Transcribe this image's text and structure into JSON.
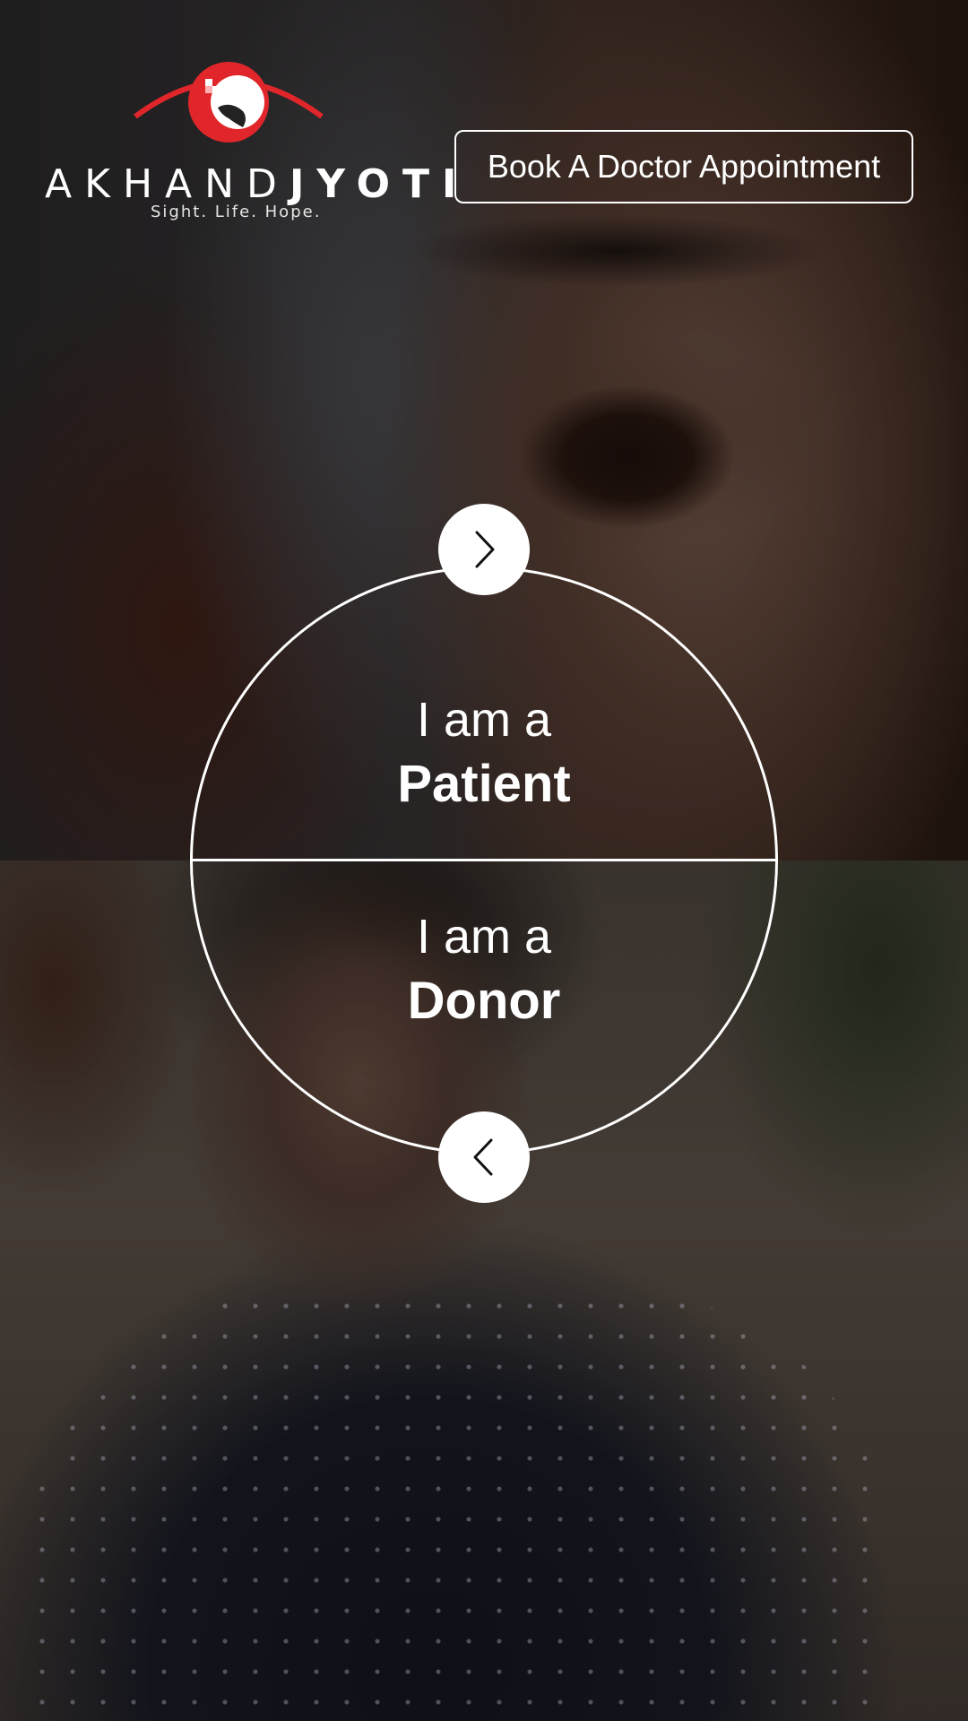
{
  "brand": {
    "name_light": "AKHAND",
    "name_bold": "JYOTI",
    "tagline": "Sight. Life. Hope.",
    "accent_color": "#e0262a"
  },
  "header": {
    "book_button_label": "Book A Doctor  Appointment"
  },
  "selector": {
    "patient": {
      "prefix": "I am a",
      "label": "Patient"
    },
    "donor": {
      "prefix": "I am a",
      "label": "Donor"
    },
    "next_icon": "chevron-right-icon",
    "prev_icon": "chevron-left-icon"
  }
}
